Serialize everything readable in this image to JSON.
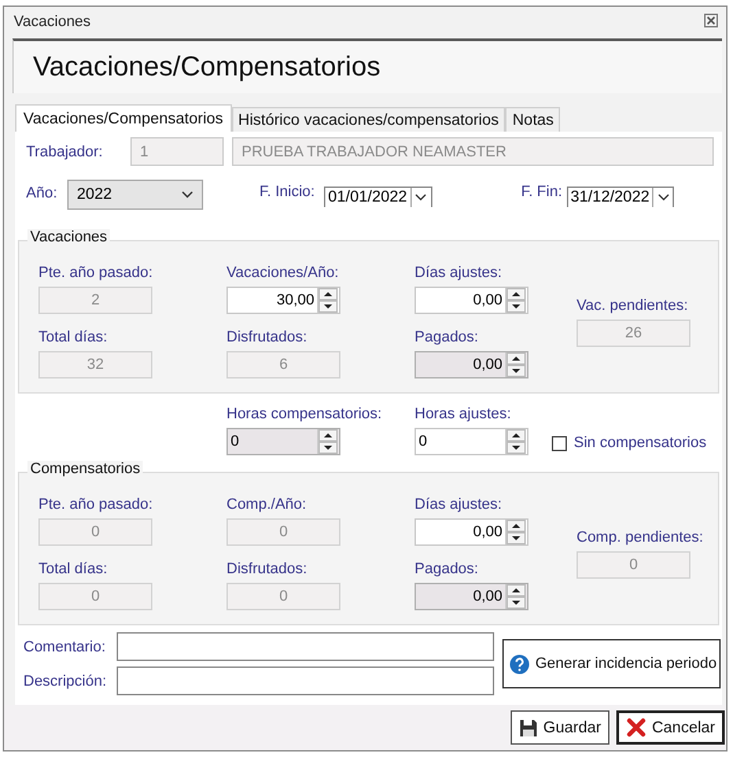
{
  "window": {
    "title": "Vacaciones"
  },
  "header": {
    "title": "Vacaciones/Compensatorios"
  },
  "tabs": [
    {
      "label": "Vacaciones/Compensatorios",
      "selected": true
    },
    {
      "label": "Histórico vacaciones/compensatorios",
      "selected": false
    },
    {
      "label": "Notas",
      "selected": false
    }
  ],
  "worker": {
    "label": "Trabajador:",
    "id": "1",
    "name": "PRUEBA TRABAJADOR NEAMASTER"
  },
  "period": {
    "year": {
      "label": "Año:",
      "value": "2022"
    },
    "start": {
      "label": "F. Inicio:",
      "value": "01/01/2022"
    },
    "end": {
      "label": "F. Fin:",
      "value": "31/12/2022"
    }
  },
  "vacaciones": {
    "title": "Vacaciones",
    "fields": [
      {
        "label": "Pte. año pasado:",
        "value": "2",
        "kind": "readonly"
      },
      {
        "label": "Vacaciones/Año:",
        "value": "30,00",
        "kind": "decimal",
        "disabled": false
      },
      {
        "label": "Días ajustes:",
        "value": "0,00",
        "kind": "decimal",
        "disabled": false
      },
      {
        "label": "Total días:",
        "value": "32",
        "kind": "readonly"
      },
      {
        "label": "Disfrutados:",
        "value": "6",
        "kind": "readonly"
      },
      {
        "label": "Pagados:",
        "value": "0,00",
        "kind": "decimal",
        "disabled": true
      },
      {
        "label": "Vac. pendientes:",
        "value": "26",
        "kind": "readonly"
      }
    ]
  },
  "hours": [
    {
      "label": "Horas compensatorios:",
      "value": "0",
      "kind": "integer",
      "disabled": true
    },
    {
      "label": "Horas ajustes:",
      "value": "0",
      "kind": "integer",
      "disabled": false
    }
  ],
  "no_compensation": {
    "label": "Sin compensatorios",
    "checked": false
  },
  "compensatorios": {
    "title": "Compensatorios",
    "fields": [
      {
        "label": "Pte. año pasado:",
        "value": "0",
        "kind": "readonly"
      },
      {
        "label": "Comp./Año:",
        "value": "0",
        "kind": "readonly"
      },
      {
        "label": "Días ajustes:",
        "value": "0,00",
        "kind": "decimal",
        "disabled": false
      },
      {
        "label": "Total días:",
        "value": "0",
        "kind": "readonly"
      },
      {
        "label": "Disfrutados:",
        "value": "0",
        "kind": "readonly"
      },
      {
        "label": "Pagados:",
        "value": "0,00",
        "kind": "decimal",
        "disabled": true
      },
      {
        "label": "Comp. pendientes:",
        "value": "0",
        "kind": "readonly"
      }
    ]
  },
  "notes": [
    {
      "label": "Comentario:"
    },
    {
      "label": "Descripción:"
    }
  ],
  "generate_button": {
    "label": "Generar incidencia periodo"
  },
  "buttons": [
    {
      "label": "Guardar",
      "kind": "save"
    },
    {
      "label": "Cancelar",
      "kind": "cancel"
    }
  ]
}
